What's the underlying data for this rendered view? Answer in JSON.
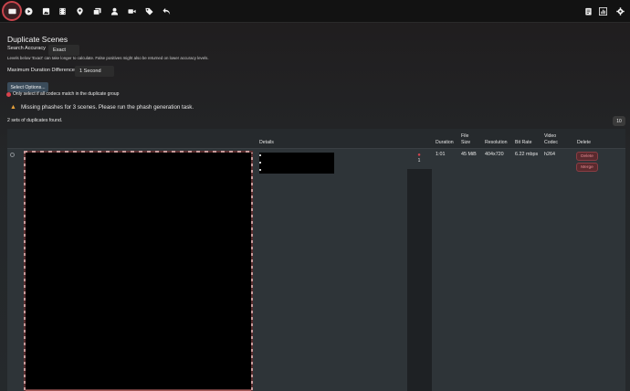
{
  "nav": {
    "items": [
      {
        "name": "scenes",
        "icon": "film-strip-icon"
      },
      {
        "name": "play",
        "icon": "play-icon"
      },
      {
        "name": "images",
        "icon": "image-icon"
      },
      {
        "name": "movies",
        "icon": "film-icon"
      },
      {
        "name": "markers",
        "icon": "map-pin-icon"
      },
      {
        "name": "galleries",
        "icon": "gallery-icon"
      },
      {
        "name": "performers",
        "icon": "user-icon"
      },
      {
        "name": "studios",
        "icon": "video-camera-icon"
      },
      {
        "name": "tags",
        "icon": "tag-icon"
      },
      {
        "name": "undo",
        "icon": "undo-icon"
      },
      {
        "name": "notes",
        "icon": "clipboard-icon"
      },
      {
        "name": "stats",
        "icon": "chart-icon"
      },
      {
        "name": "settings",
        "icon": "gear-icon"
      }
    ]
  },
  "page": {
    "title": "Duplicate Scenes",
    "accuracy_label": "Search Accuracy",
    "accuracy_value": "Exact",
    "accuracy_hint": "Levels below 'Exact' can take longer to calculate. False positives might also be returned on lower accuracy levels.",
    "duration_label": "Maximum Duration Difference",
    "duration_value": "1 Second",
    "select_options_label": "Select Options...",
    "codec_note": "Only select if all codecs match in the duplicate group",
    "warning_text": "Missing phashes for 3 scenes. Please run the phash generation task.",
    "found_text": "2 sets of duplicates found.",
    "page_size": "10"
  },
  "table": {
    "headers": {
      "details": "Details",
      "duration": "Duration",
      "file_size_1": "File",
      "file_size_2": "Size",
      "resolution": "Resolution",
      "bit_rate": "Bit Rate",
      "video_codec_1": "Video",
      "video_codec_2": "Codec",
      "delete": "Delete"
    },
    "row": {
      "performer_count": "1",
      "duration": "1:01",
      "file_size": "45 MiB",
      "resolution": "404x720",
      "bit_rate": "6.22 mbps",
      "video_codec": "h264",
      "delete_label": "Delete",
      "merge_label": "Merge"
    }
  },
  "colors": {
    "accent_red": "#d8434d",
    "warning": "#e8a23b",
    "button_blue": "#3a4b5a"
  }
}
